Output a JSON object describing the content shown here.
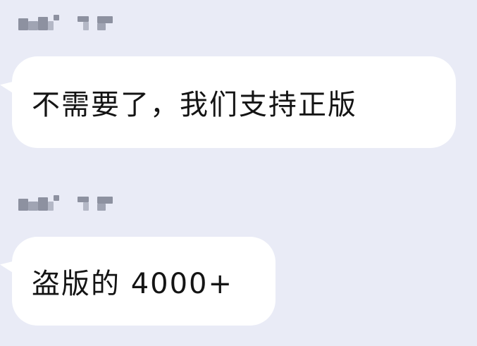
{
  "messages": [
    {
      "sender_blurred": true,
      "text": "不需要了，我们支持正版"
    },
    {
      "sender_blurred": true,
      "text": "盗版的 4000+"
    }
  ],
  "colors": {
    "background": "#e9ebf6",
    "bubble": "#ffffff",
    "text": "#141414",
    "blur": "#8d91a0"
  }
}
